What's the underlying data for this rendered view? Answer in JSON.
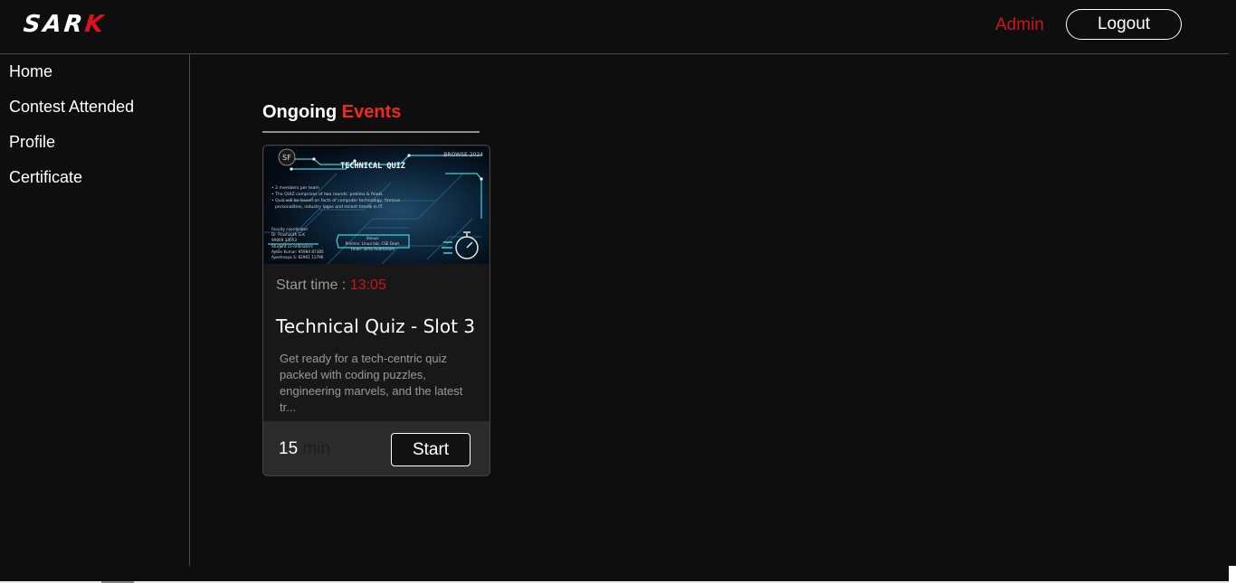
{
  "header": {
    "logo_part1": "SAR",
    "logo_part2": "K",
    "user_role": "Admin",
    "logout_label": "Logout"
  },
  "sidebar": {
    "items": [
      {
        "label": "Home"
      },
      {
        "label": "Contest Attended"
      },
      {
        "label": "Profile"
      },
      {
        "label": "Certificate"
      }
    ]
  },
  "main": {
    "section_title_part1": "Ongoing",
    "section_title_part2": "Events",
    "events": [
      {
        "image": {
          "banner_tag": "BROWSE 2024",
          "heading": "TECHNICAL QUIZ",
          "bullet1": "• 2 members per team",
          "bullet2": "• The QUIZ comprises of two rounds: prelims & finals.",
          "bullet3": "• Quiz will be based on facts of computer technology, famous",
          "bullet3b": "personalities, industry logos and recent trends in IT.",
          "faculty_head": "Faculty coordinator",
          "faculty_name": "Dr. Prashanth G.K",
          "faculty_phone": "99809 33053",
          "student_head": "Student co-ordinators",
          "student1": "Aman Kumar: 95984 87385",
          "student2": "Ayeshnaya S: 82961 11796",
          "venue_head": "Venue:",
          "venue1": "Prelims: Linux lab, CSE Dept.",
          "venue2": "Finals: Birla Auditorium"
        },
        "start_time_label": "Start time :",
        "start_time_value": "13:05",
        "title": "Technical Quiz - Slot 3",
        "description": "Get ready for a tech-centric quiz packed with coding puzzles, engineering marvels, and the latest tr...",
        "duration_value": "15",
        "duration_unit": "min",
        "start_label": "Start"
      }
    ]
  },
  "colors": {
    "background": "#0f0e0e",
    "accent_red": "#d0141c",
    "events_red": "#ef2b1e"
  }
}
